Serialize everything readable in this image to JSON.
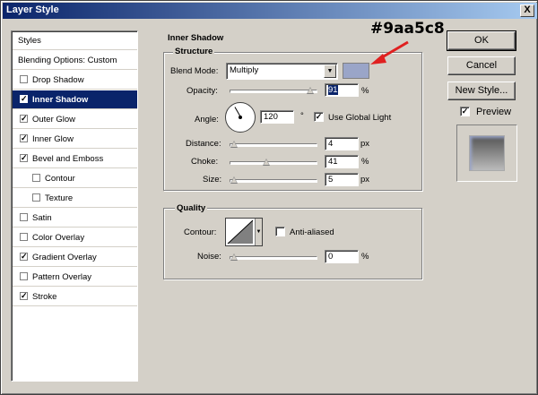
{
  "window": {
    "title": "Layer Style",
    "close_glyph": "X"
  },
  "styles_list": {
    "header": "Styles",
    "blending": "Blending Options: Custom",
    "items": [
      {
        "label": "Drop Shadow",
        "checked": false,
        "indent": false,
        "selected": false
      },
      {
        "label": "Inner Shadow",
        "checked": true,
        "indent": false,
        "selected": true
      },
      {
        "label": "Outer Glow",
        "checked": true,
        "indent": false,
        "selected": false
      },
      {
        "label": "Inner Glow",
        "checked": true,
        "indent": false,
        "selected": false
      },
      {
        "label": "Bevel and Emboss",
        "checked": true,
        "indent": false,
        "selected": false
      },
      {
        "label": "Contour",
        "checked": false,
        "indent": true,
        "selected": false
      },
      {
        "label": "Texture",
        "checked": false,
        "indent": true,
        "selected": false
      },
      {
        "label": "Satin",
        "checked": false,
        "indent": false,
        "selected": false
      },
      {
        "label": "Color Overlay",
        "checked": false,
        "indent": false,
        "selected": false
      },
      {
        "label": "Gradient Overlay",
        "checked": true,
        "indent": false,
        "selected": false
      },
      {
        "label": "Pattern Overlay",
        "checked": false,
        "indent": false,
        "selected": false
      },
      {
        "label": "Stroke",
        "checked": true,
        "indent": false,
        "selected": false
      }
    ]
  },
  "inner_shadow": {
    "title": "Inner Shadow",
    "structure_title": "Structure",
    "blend_mode_label": "Blend Mode:",
    "blend_mode_value": "Multiply",
    "shadow_color": "#9aa5c8",
    "opacity_label": "Opacity:",
    "opacity_value": "91",
    "opacity_unit": "%",
    "angle_label": "Angle:",
    "angle_value": "120",
    "angle_unit": "°",
    "global_light_label": "Use Global Light",
    "global_light_checked": true,
    "distance_label": "Distance:",
    "distance_value": "4",
    "distance_unit": "px",
    "choke_label": "Choke:",
    "choke_value": "41",
    "choke_unit": "%",
    "size_label": "Size:",
    "size_value": "5",
    "size_unit": "px"
  },
  "quality": {
    "title": "Quality",
    "contour_label": "Contour:",
    "anti_aliased_label": "Anti-aliased",
    "anti_aliased_checked": false,
    "noise_label": "Noise:",
    "noise_value": "0",
    "noise_unit": "%"
  },
  "buttons": {
    "ok": "OK",
    "cancel": "Cancel",
    "new_style": "New Style...",
    "preview_label": "Preview",
    "preview_checked": true
  },
  "annotation": {
    "text": "#9aa5c8",
    "arrow_color": "#e02020"
  }
}
